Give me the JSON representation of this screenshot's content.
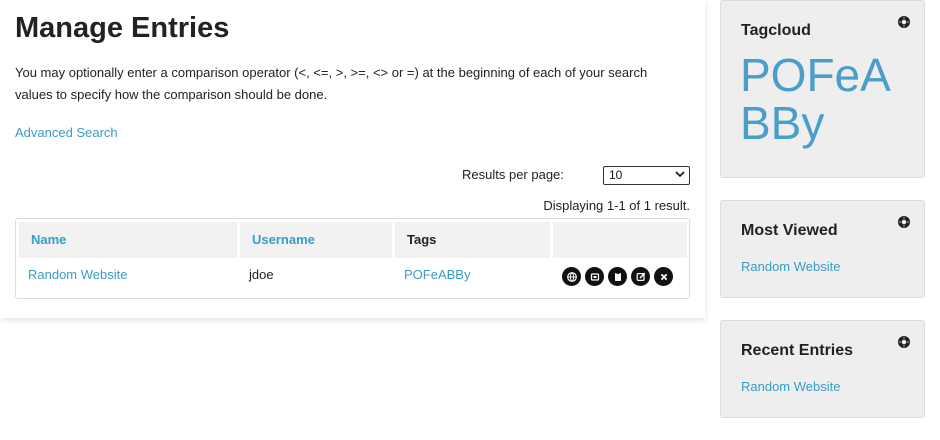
{
  "main": {
    "title": "Manage Entries",
    "intro": "You may optionally enter a comparison operator (<, <=, >, >=, <> or =) at the beginning of each of your search values to specify how the comparison should be done.",
    "advanced_search": "Advanced Search",
    "results_per_page_label": "Results per page:",
    "results_per_page_value": "10",
    "displaying": "Displaying 1-1 of 1 result.",
    "table": {
      "headers": [
        "Name",
        "Username",
        "Tags",
        ""
      ],
      "rows": [
        {
          "name": "Random Website",
          "username": "jdoe",
          "tags": "POFeABBy"
        }
      ],
      "actions": [
        "globe-icon",
        "copy-icon",
        "clipboard-icon",
        "edit-icon",
        "delete-icon"
      ]
    }
  },
  "sidebar": {
    "tagcloud": {
      "title": "Tagcloud",
      "tag": "POFeABBy"
    },
    "most_viewed": {
      "title": "Most Viewed",
      "item": "Random Website"
    },
    "recent_entries": {
      "title": "Recent Entries",
      "item": "Random Website"
    }
  },
  "colors": {
    "link": "#3a9cc6",
    "sidebar_bg": "#eeeeee",
    "header_bg": "#f2f2f2"
  }
}
